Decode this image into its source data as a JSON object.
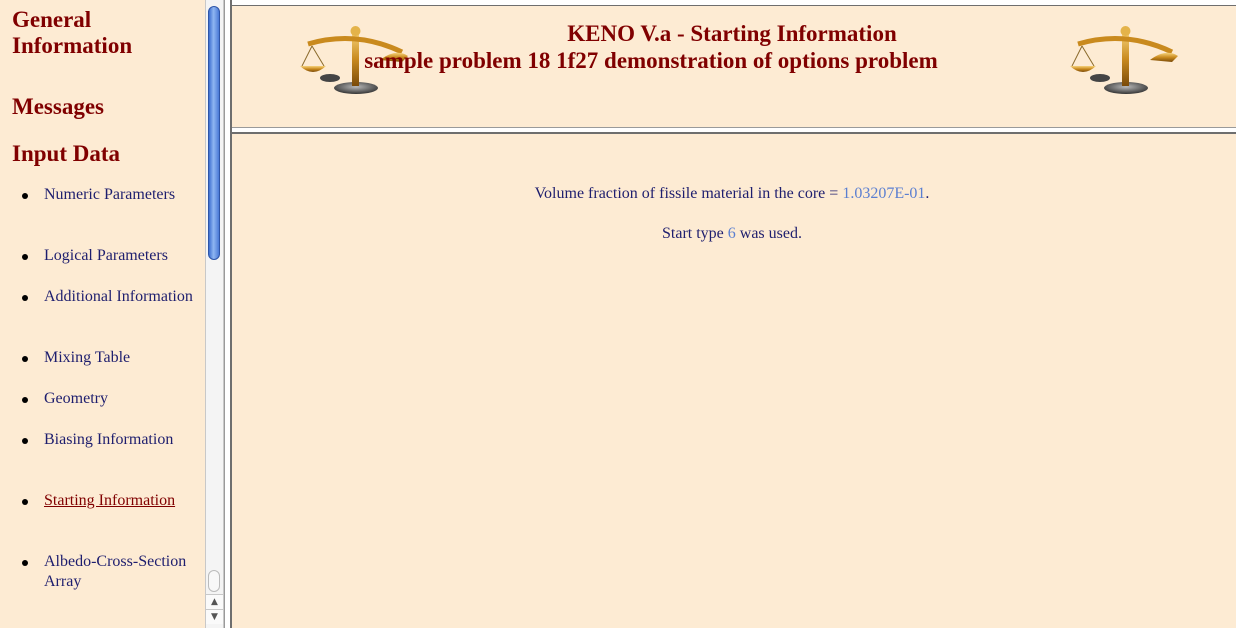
{
  "nav": {
    "general": "General Information",
    "messages": "Messages",
    "input_data": "Input Data",
    "items": [
      {
        "label": "Numeric Parameters"
      },
      {
        "label": "Logical Parameters"
      },
      {
        "label": "Additional Information"
      },
      {
        "label": "Mixing Table"
      },
      {
        "label": "Geometry"
      },
      {
        "label": "Biasing Information"
      },
      {
        "label": "Starting Information",
        "active": true
      },
      {
        "label": "Albedo-Cross-Section Array"
      }
    ]
  },
  "header": {
    "title": "KENO V.a - Starting Information",
    "subtitle": "sample problem 18 1f27 demonstration of options problem",
    "icons": [
      "balance-scale-icon",
      "balance-scale-icon"
    ]
  },
  "main": {
    "volume_prefix": "Volume fraction of fissile material in the core =",
    "volume_value": "1.03207E-01",
    "volume_suffix": ".",
    "start_prefix": "Start type",
    "start_value": "6",
    "start_suffix": "was used."
  },
  "scrollbar": {
    "up_arrow": "▲",
    "down_arrow": "▼"
  },
  "colors": {
    "background": "#fdebd3",
    "heading": "#800000",
    "text": "#1e1e6e",
    "value": "#5b7fd1"
  }
}
